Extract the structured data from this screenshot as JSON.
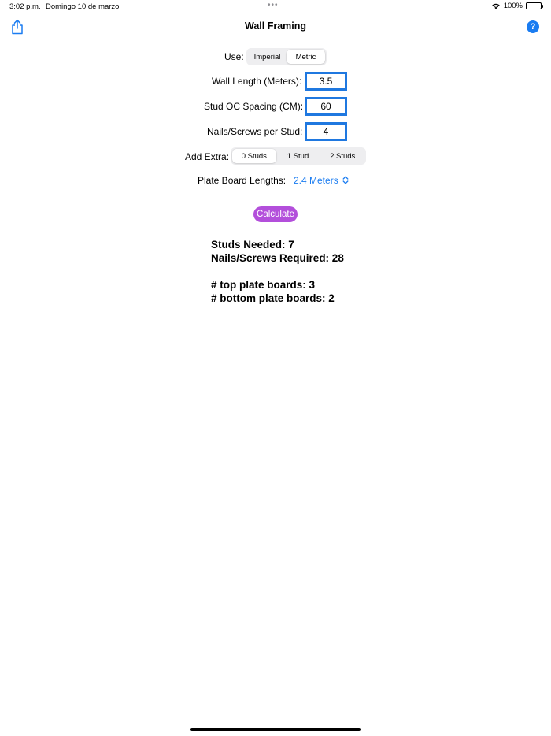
{
  "status_bar": {
    "time": "3:02 p.m.",
    "date": "Domingo 10 de marzo",
    "multitask_dots": "•••",
    "battery": "100%"
  },
  "nav": {
    "title": "Wall Framing",
    "help_label": "?"
  },
  "units": {
    "label": "Use:",
    "options": [
      "Imperial",
      "Metric"
    ],
    "selected": "Metric"
  },
  "wall_length": {
    "label": "Wall Length (Meters):",
    "value": "3.5"
  },
  "stud_spacing": {
    "label": "Stud OC Spacing (CM):",
    "value": "60"
  },
  "nails_per_stud": {
    "label": "Nails/Screws per Stud:",
    "value": "4"
  },
  "add_extra": {
    "label": "Add Extra:",
    "options": [
      "0 Studs",
      "1 Stud",
      "2 Studs"
    ],
    "selected": "0 Studs"
  },
  "plate_board": {
    "label": "Plate Board Lengths:",
    "value": "2.4 Meters",
    "chevron": "⌃⌄"
  },
  "calculate_label": "Calculate",
  "results": {
    "studs_needed": "Studs Needed: 7",
    "nails_required": "Nails/Screws Required: 28",
    "top_plate": "# top plate boards: 3",
    "bottom_plate": "# bottom plate boards: 2"
  },
  "colors": {
    "accent": "#1a7cf1",
    "field_border": "#1f78e0",
    "calculate_button": "#b34fdb"
  }
}
